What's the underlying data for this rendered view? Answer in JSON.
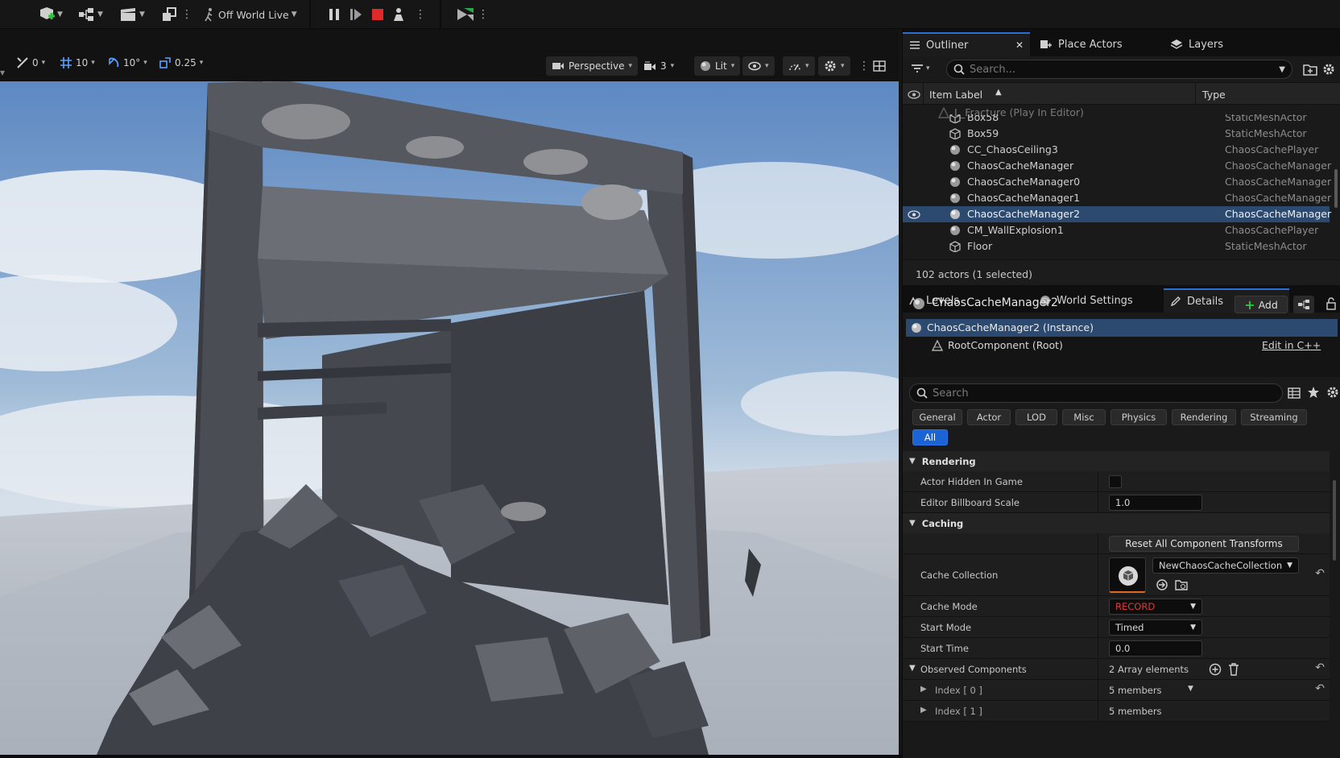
{
  "toolbar": {
    "live_label": "Off World Live"
  },
  "viewport_bar": {
    "move_snap": "0",
    "grid_snap": "10",
    "rotate_snap": "10°",
    "scale_snap": "0.25",
    "view_mode": "Perspective",
    "camera_speed": "3",
    "lighting": "Lit"
  },
  "outliner": {
    "tabs": [
      {
        "label": "Outliner"
      },
      {
        "label": "Place Actors"
      },
      {
        "label": "Layers"
      }
    ],
    "search_placeholder": "Search...",
    "col_label": "Item Label",
    "col_type": "Type",
    "level_row": "L_Fracture (Play In Editor)",
    "rows": [
      {
        "label": "Box58",
        "type": "StaticMeshActor"
      },
      {
        "label": "Box59",
        "type": "StaticMeshActor"
      },
      {
        "label": "CC_ChaosCeiling3",
        "type": "ChaosCachePlayer"
      },
      {
        "label": "ChaosCacheManager",
        "type": "ChaosCacheManager"
      },
      {
        "label": "ChaosCacheManager0",
        "type": "ChaosCacheManager"
      },
      {
        "label": "ChaosCacheManager1",
        "type": "ChaosCacheManager"
      },
      {
        "label": "ChaosCacheManager2",
        "type": "ChaosCacheManager"
      },
      {
        "label": "CM_WallExplosion1",
        "type": "ChaosCachePlayer"
      },
      {
        "label": "Floor",
        "type": "StaticMeshActor"
      }
    ],
    "status": "102 actors (1 selected)"
  },
  "details": {
    "tabs": [
      {
        "label": "Levels"
      },
      {
        "label": "World Settings"
      },
      {
        "label": "Details"
      }
    ],
    "actor_name": "ChaosCacheManager2",
    "add_label": "Add",
    "instance_label": "ChaosCacheManager2 (Instance)",
    "root_label": "RootComponent (Root)",
    "edit_cpp": "Edit in C++",
    "search_placeholder": "Search",
    "filters": [
      "General",
      "Actor",
      "LOD",
      "Misc",
      "Physics",
      "Rendering",
      "Streaming"
    ],
    "filter_all": "All",
    "rendering": {
      "header": "Rendering",
      "hidden_label": "Actor Hidden In Game",
      "billboard_label": "Editor Billboard Scale",
      "billboard_value": "1.0"
    },
    "caching": {
      "header": "Caching",
      "reset_button": "Reset All Component Transforms",
      "collection_label": "Cache Collection",
      "collection_value": "NewChaosCacheCollection",
      "mode_label": "Cache Mode",
      "mode_value": "RECORD",
      "start_mode_label": "Start Mode",
      "start_mode_value": "Timed",
      "start_time_label": "Start Time",
      "start_time_value": "0.0",
      "observed_label": "Observed Components",
      "observed_value": "2 Array elements",
      "index0_label": "Index [ 0 ]",
      "index0_value": "5 members",
      "index1_label": "Index [ 1 ]",
      "index1_value": "5 members"
    },
    "record_color": "#e03a3a"
  }
}
